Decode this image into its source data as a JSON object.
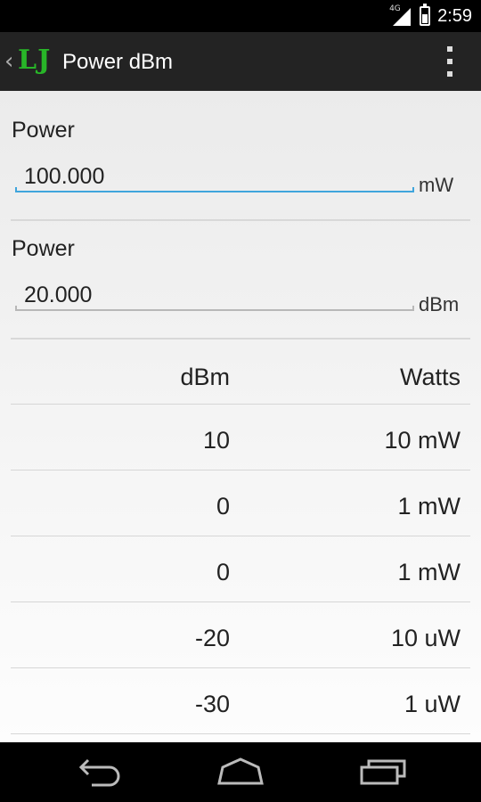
{
  "status_bar": {
    "network": "4G",
    "time": "2:59",
    "battery_level": 0.6
  },
  "action_bar": {
    "back_glyph": "‹",
    "logo": "LJ",
    "title": "Power dBm"
  },
  "mw_input": {
    "label": "Power",
    "value": "100.000",
    "unit": "mW"
  },
  "dbm_input": {
    "label": "Power",
    "value": "20.000",
    "unit": "dBm"
  },
  "table": {
    "headers": {
      "dbm": "dBm",
      "watts": "Watts"
    },
    "rows": [
      {
        "dbm": "10",
        "watts": "10 mW"
      },
      {
        "dbm": "0",
        "watts": "1 mW"
      },
      {
        "dbm": "0",
        "watts": "1 mW"
      },
      {
        "dbm": "-20",
        "watts": "10 uW"
      },
      {
        "dbm": "-30",
        "watts": "1 uW"
      }
    ]
  },
  "colors": {
    "focus_line": "#3fa5dc",
    "inactive_line": "#b8b8b8",
    "logo": "#28b628",
    "action_bar": "#232323"
  },
  "icons": [
    "signal-icon",
    "battery-icon",
    "back-chevron-icon",
    "overflow-menu-icon",
    "nav-back-icon",
    "nav-home-icon",
    "nav-recents-icon"
  ]
}
